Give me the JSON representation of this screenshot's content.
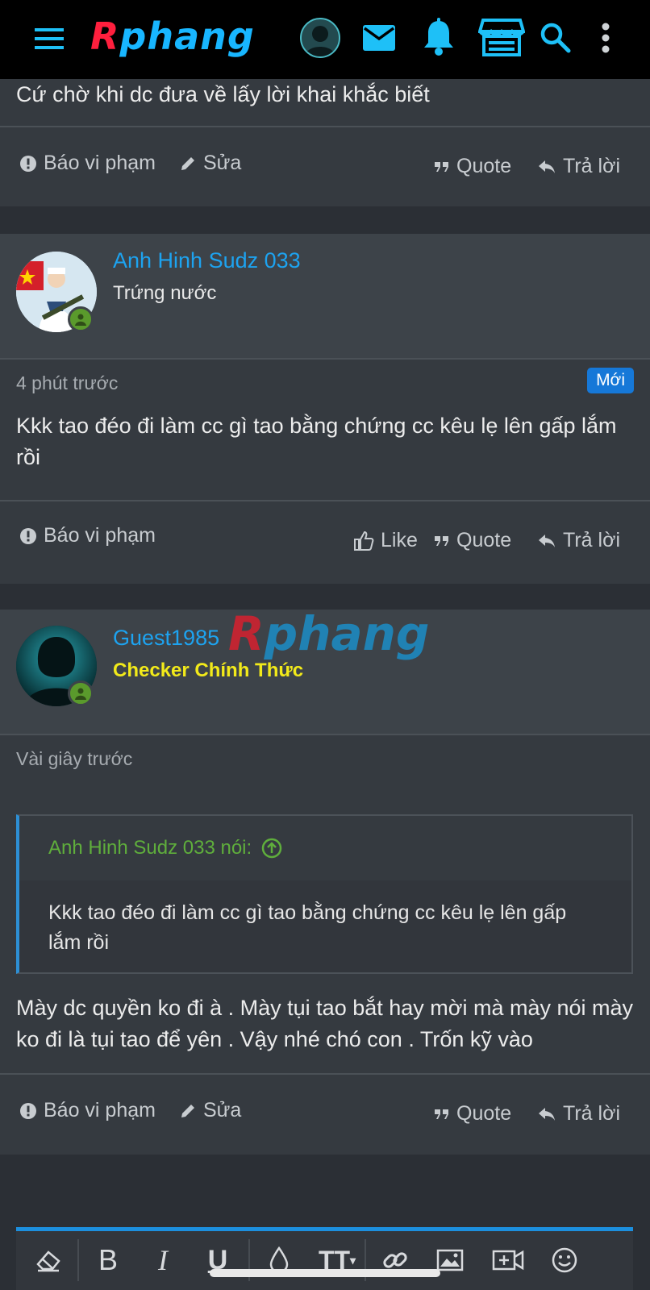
{
  "topbar": {
    "logo_first": "R",
    "logo_rest": "phang",
    "icons": [
      "menu-icon",
      "avatar",
      "mail-icon",
      "bell-icon",
      "store-icon",
      "search-icon",
      "more-vert-icon"
    ],
    "accent": "#1ec0f7"
  },
  "post1": {
    "text_tail": "Cứ chờ khi dc đưa về lấy lời khai khắc biết",
    "report": "Báo vi phạm",
    "edit": "Sửa",
    "quote": "Quote",
    "reply": "Trả lời"
  },
  "post2": {
    "username": "Anh Hinh Sudz 033",
    "user_title": "Trứng nước",
    "time": "4 phút trước",
    "badge": "Mới",
    "text": "Kkk tao đéo đi làm cc gì tao bằng chứng cc kêu lẹ lên gấp lắm rồi",
    "report": "Báo vi phạm",
    "like": "Like",
    "quote": "Quote",
    "reply": "Trả lời"
  },
  "post3": {
    "username": "Guest1985",
    "user_title": "Checker Chính Thức",
    "time": "Vài giây trước",
    "quote_author": "Anh Hinh Sudz 033 nói:",
    "quote_text": "Kkk tao đéo đi làm cc gì tao bằng chứng cc kêu lẹ lên gấp lắm rồi",
    "text": "Mày dc quyền ko đi à . Mày tụi tao bắt hay mời mà mày nói mày ko đi là tụi tao để yên . Vậy nhé chó con . Trốn kỹ vào",
    "report": "Báo vi phạm",
    "edit": "Sửa",
    "quote": "Quote",
    "reply": "Trả lời"
  },
  "watermark": {
    "first": "R",
    "rest": "phang"
  },
  "editor": {
    "tools": [
      "eraser-icon",
      "bold-icon",
      "italic-icon",
      "underline-icon",
      "color-drop-icon",
      "text-size-icon",
      "link-icon",
      "image-icon",
      "video-add-icon",
      "emoji-icon"
    ],
    "bold": "B",
    "italic": "I",
    "underline": "U",
    "text_size": "TT"
  },
  "colors": {
    "username": "#1da3f0",
    "checker_title": "#f2ea1a",
    "online": "#5a9a2c",
    "quote_author": "#5fae3c",
    "new_badge": "#1678d8"
  }
}
